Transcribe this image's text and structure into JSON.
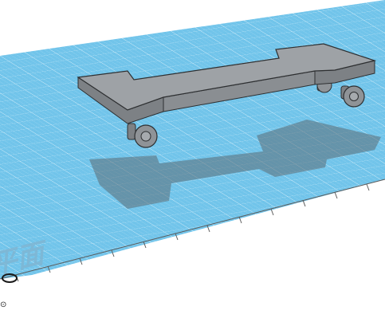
{
  "workplane": {
    "label": "工作平面",
    "grid_color": "#6ec3ea",
    "grid_line_color": "#ffffff",
    "ruler_color": "#5a5a5a"
  },
  "model": {
    "body_top_color": "#9ea2a6",
    "body_side_color": "#7d8185",
    "shadow_color": "#5b6b75",
    "wheel_color": "#8f9397",
    "wheel_count": 4
  },
  "view_origin": {
    "icon": "origin-ring-icon",
    "glyph": "⊙"
  }
}
